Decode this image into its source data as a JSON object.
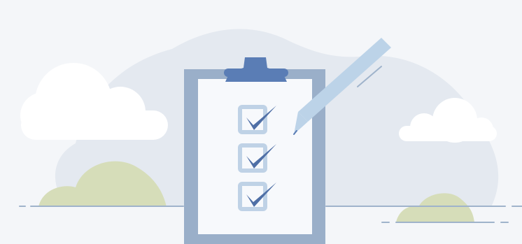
{
  "illustration": {
    "subject": "clipboard-checklist",
    "checklist": {
      "total_items": 3,
      "checked_items": 3
    },
    "colors": {
      "background": "#f4f6f9",
      "backdrop_blob": "#e4e9f0",
      "cloud": "#ffffff",
      "bush": "#d6ddb9",
      "ground_line": "#9fb3cb",
      "board": "#9aafc9",
      "paper": "#f7f9fc",
      "clip": "#5a7db5",
      "checkbox": "#bfd2e6",
      "checkmark": "#4f6fa6",
      "pen": "#bcd3e8"
    }
  }
}
